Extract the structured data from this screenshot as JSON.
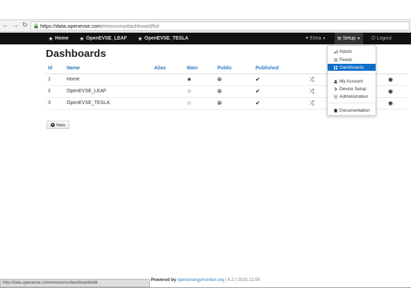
{
  "browser": {
    "url_host": "https://data.openevse.com",
    "url_path": "/emoncms/dashboard/list"
  },
  "navbar": {
    "left_links": [
      {
        "label": "Home"
      },
      {
        "label": "OpenEVSE_LEAF"
      },
      {
        "label": "OpenEVSE_TESLA"
      }
    ],
    "extra_label": "Extra",
    "setup_label": "Setup",
    "logout_label": "Logout"
  },
  "page": {
    "title": "Dashboards"
  },
  "table": {
    "headers": [
      "Id",
      "Name",
      "Alias",
      "Main",
      "Public",
      "Published"
    ],
    "rows": [
      {
        "id": "1",
        "name": "Home",
        "alias": ""
      },
      {
        "id": "2",
        "name": "OpenEVSE_LEAF",
        "alias": ""
      },
      {
        "id": "3",
        "name": "OpenEVSE_TESLA",
        "alias": ""
      }
    ]
  },
  "new_button_label": "New",
  "setup_menu": {
    "items": [
      {
        "label": "Inputs"
      },
      {
        "label": "Feeds"
      },
      {
        "label": "Dashboards"
      },
      {
        "label": "My Account"
      },
      {
        "label": "Device Setup"
      },
      {
        "label": "Administration"
      },
      {
        "label": "Documentation"
      }
    ]
  },
  "footer": {
    "powered_by": "Powered by",
    "link": "openenergymonitor.org",
    "version": "| 9.2 | 2015.12.05"
  },
  "statusbar_text": "http://data.openevse.com/emoncms/dashboard/edit",
  "colors": {
    "navbar_bg": "#111111",
    "link_blue": "#2a7bbf",
    "menu_active": "#0b6fcc"
  }
}
